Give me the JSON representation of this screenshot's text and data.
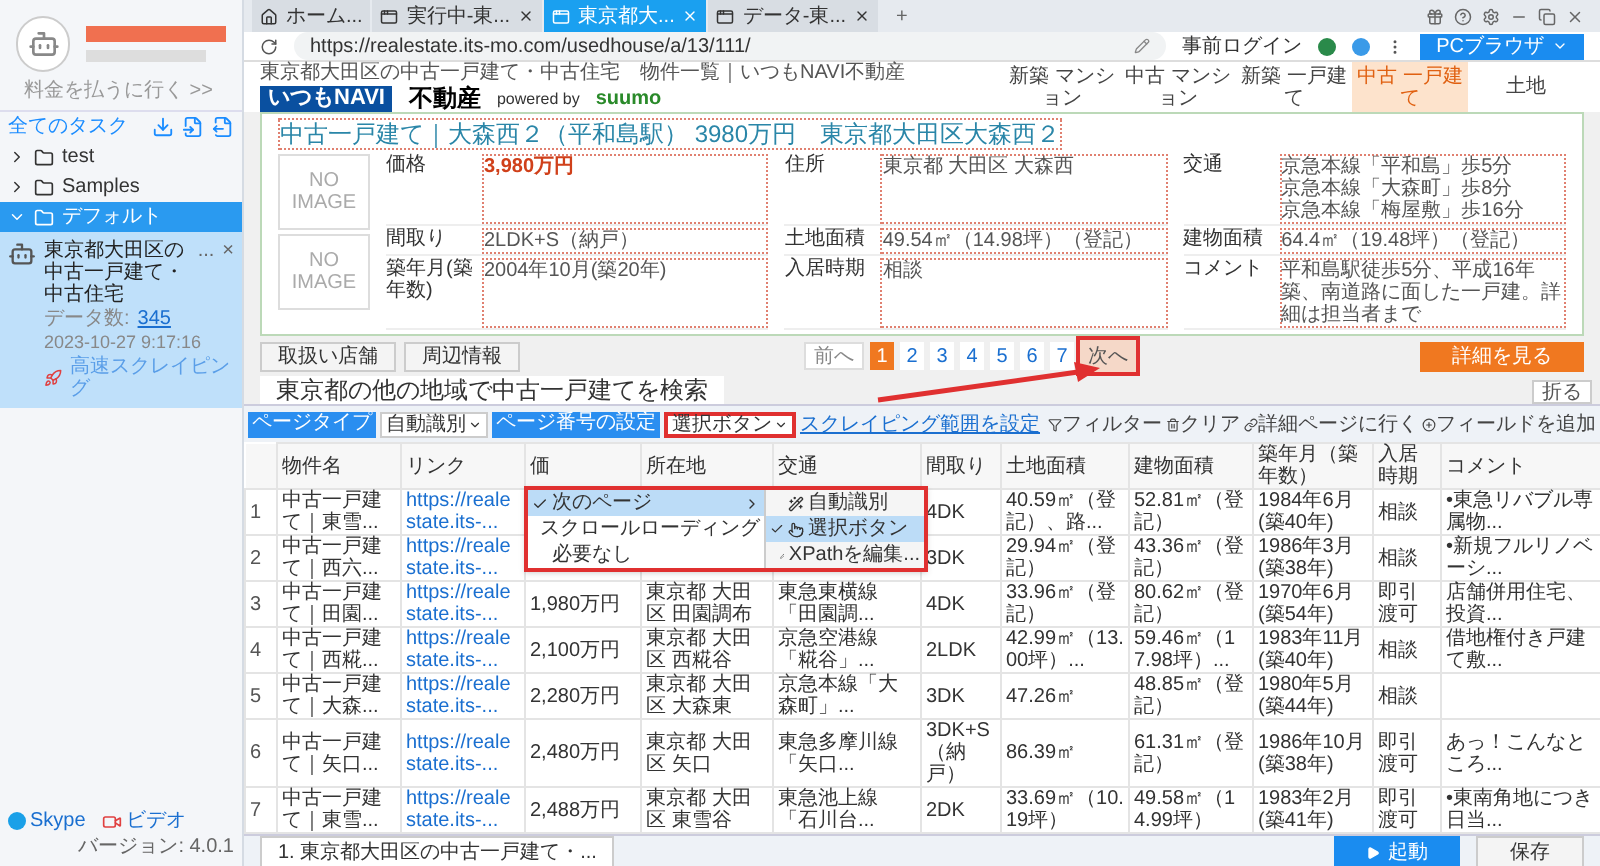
{
  "sidebar": {
    "billing_link": "料金を払うに行く >>",
    "all_tasks": "全てのタスク",
    "folders": [
      {
        "name": "test",
        "expanded": false,
        "selected": false
      },
      {
        "name": "Samples",
        "expanded": false,
        "selected": false
      },
      {
        "name": "デフォルト",
        "expanded": true,
        "selected": true,
        "children": [
          {
            "title": "東京都大田区の中古一戸建て・中古住宅",
            "more": "...",
            "close": "×",
            "data_label": "データ数:",
            "data_count": "345",
            "date": "2023-10-27 9:17:16",
            "mode": "高速スクレイピング"
          }
        ]
      }
    ],
    "links": [
      "Skype",
      "ビデオ"
    ],
    "version": "バージョン: 4.0.1"
  },
  "browser": {
    "tabs": [
      {
        "label": "ホーム...",
        "kind": "home",
        "selected": false
      },
      {
        "label": "実行中-東...",
        "kind": "page",
        "selected": false
      },
      {
        "label": "東京都大...",
        "kind": "page",
        "selected": true
      },
      {
        "label": "データ-東...",
        "kind": "page",
        "selected": false
      }
    ],
    "new_tab": "+",
    "url": "https://realestate.its-mo.com/usedhouse/a/13/111/",
    "prelogin": "事前ログイン",
    "pc_browser": "PCブラウザ"
  },
  "page": {
    "breadcrumb": "東京都大田区の中古一戸建て・中古住宅　物件一覧｜いつもNAVI不動産",
    "logo": {
      "brand": "いつもNAVI",
      "sub": "不動産",
      "powered": "powered by",
      "partner": "suumo"
    },
    "nav": [
      {
        "label": "新築 マンション",
        "selected": false
      },
      {
        "label": "中古 マンション",
        "selected": false
      },
      {
        "label": "新築 一戸建て",
        "selected": false
      },
      {
        "label": "中古 一戸建て",
        "selected": true
      },
      {
        "label": "土地",
        "selected": false
      }
    ],
    "title": "中古一戸建て｜大森西２（平和島駅） 3980万円　東京都大田区大森西２",
    "images": [
      "NO IMAGE",
      "NO IMAGE"
    ],
    "details": [
      {
        "label": "価格",
        "lines": [
          "3,980万円"
        ],
        "highlight": true
      },
      {
        "label": "住所",
        "lines": [
          "東京都 大田区 大森西"
        ],
        "highlight": false
      },
      {
        "label": "交通",
        "lines": [
          "京急本線「平和島」歩5分",
          "京急本線「大森町」歩8分",
          "京急本線「梅屋敷」歩16分"
        ],
        "highlight": false
      },
      {
        "label": "間取り",
        "lines": [
          "2LDK+S（納戸）"
        ],
        "highlight": false
      },
      {
        "label": "土地面積",
        "lines": [
          "49.54㎡（14.98坪）（登記）"
        ],
        "highlight": false
      },
      {
        "label": "建物面積",
        "lines": [
          "64.4㎡（19.48坪）（登記）"
        ],
        "highlight": false
      },
      {
        "label": "築年月(築年数)",
        "lines": [
          "2004年10月(築20年)"
        ],
        "highlight": false
      },
      {
        "label": "入居時期",
        "lines": [
          "相談"
        ],
        "highlight": false
      },
      {
        "label": "コメント",
        "lines": [
          "平和島駅徒歩5分、平成16年築、南道路に面した一戸建。詳細は担当者まで"
        ],
        "highlight": false
      }
    ],
    "buttons": [
      "取扱い店舗",
      "周辺情報"
    ],
    "detail_button": "詳細を見る",
    "pagination": {
      "prev": "前へ",
      "pages": [
        {
          "label": "1",
          "selected": true
        },
        {
          "label": "2",
          "selected": false
        },
        {
          "label": "3",
          "selected": false
        },
        {
          "label": "4",
          "selected": false
        },
        {
          "label": "5",
          "selected": false
        },
        {
          "label": "6",
          "selected": false
        },
        {
          "label": "7",
          "selected": false
        }
      ],
      "next": "次へ"
    },
    "section_heading": "東京都の他の地域で中古一戸建てを検索",
    "collapse": "折る"
  },
  "toolbar": {
    "page_type_label": "ページタイプ",
    "page_type_value": "自動識別",
    "page_number_label": "ページ番号の設定",
    "page_number_value": "選択ボタン",
    "range_link": "スクレイピング範囲を設定",
    "actions": [
      {
        "label": "フィルター",
        "kind": "filter"
      },
      {
        "label": "クリア",
        "kind": "trash"
      },
      {
        "label": "詳細ページに行く",
        "kind": "link"
      },
      {
        "label": "フィールドを追加",
        "kind": "add"
      }
    ]
  },
  "menu": {
    "items": [
      {
        "label": "次のページ",
        "selected": true
      },
      {
        "label": "スクロールローディング",
        "selected": false
      },
      {
        "label": "必要なし",
        "selected": false
      }
    ],
    "submenu": [
      {
        "label": "自動識別",
        "kind": "auto",
        "selected": false
      },
      {
        "label": "選択ボタン",
        "kind": "click",
        "selected": true
      },
      {
        "label": "XPathを編集...",
        "kind": "edit",
        "selected": false
      }
    ]
  },
  "table": {
    "columns": [
      "物件名",
      "リンク",
      "価",
      "所在地",
      "交通",
      "間取り",
      "土地面積",
      "建物面積",
      "築年月（築年数）",
      "入居時期",
      "コメント"
    ],
    "rows": [
      {
        "index": "1",
        "cells": [
          "中古一戸建て｜東雪...",
          "https://realestate.its-...",
          null,
          null,
          null,
          "4DK",
          "40.59㎡（登記）、路...",
          "52.81㎡（登記）",
          "1984年6月(築40年)",
          "相談",
          "•東急リバブル専属物..."
        ]
      },
      {
        "index": "2",
        "cells": [
          "中古一戸建て｜西六...",
          "https://realestate.its-...",
          null,
          null,
          null,
          "3DK",
          "29.94㎡（登記）",
          "43.36㎡（登記）",
          "1986年3月(築38年)",
          "相談",
          "•新規フルリノベーシ..."
        ]
      },
      {
        "index": "3",
        "cells": [
          "中古一戸建て｜田園...",
          "https://realestate.its-...",
          "1,980万円",
          "東京都 大田区 田園調布",
          "東急東横線「田園調...",
          "4DK",
          "33.96㎡（登記）",
          "80.62㎡（登記）",
          "1970年6月(築54年)",
          "即引渡可",
          "店舗併用住宅、投資..."
        ]
      },
      {
        "index": "4",
        "cells": [
          "中古一戸建て｜西糀...",
          "https://realestate.its-...",
          "2,100万円",
          "東京都 大田区 西糀谷",
          "京急空港線「糀谷」...",
          "2LDK",
          "42.99㎡（13.00坪）...",
          "59.46㎡（17.98坪）...",
          "1983年11月(築40年)",
          "相談",
          "借地権付き戸建て敷..."
        ]
      },
      {
        "index": "5",
        "cells": [
          "中古一戸建て｜大森...",
          "https://realestate.its-...",
          "2,280万円",
          "東京都 大田区 大森東",
          "京急本線「大森町」...",
          "3DK",
          "47.26㎡",
          "48.85㎡（登記）",
          "1980年5月(築44年)",
          "相談",
          null
        ]
      },
      {
        "index": "6",
        "cells": [
          "中古一戸建て｜矢口...",
          "https://realestate.its-...",
          "2,480万円",
          "東京都 大田区 矢口",
          "東急多摩川線「矢口...",
          "3DK+S（納戸）",
          "86.39㎡",
          "61.31㎡（登記）",
          "1986年10月(築38年)",
          "即引渡可",
          "あっ！こんなところ..."
        ]
      },
      {
        "index": "7",
        "cells": [
          "中古一戸建て｜東雪...",
          "https://realestate.its-...",
          "2,488万円",
          "東京都 大田区 東雪谷",
          "東急池上線「石川台...",
          "2DK",
          "33.69㎡（10.19坪）",
          "49.58㎡（14.99坪）",
          "1983年2月(築41年)",
          "即引渡可",
          "•東南角地につき日当..."
        ]
      }
    ]
  },
  "footer": {
    "run_tabs": [
      "1. 東京都大田区の中古一戸建て・..."
    ],
    "start": "起動",
    "save": "保存"
  }
}
